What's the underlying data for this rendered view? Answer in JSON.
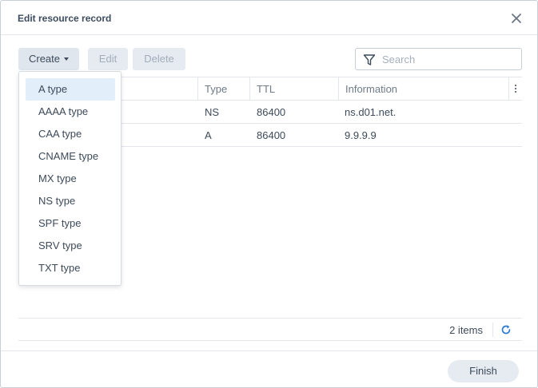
{
  "dialog": {
    "title": "Edit resource record"
  },
  "toolbar": {
    "create_label": "Create",
    "edit_label": "Edit",
    "delete_label": "Delete"
  },
  "search": {
    "placeholder": "Search",
    "value": ""
  },
  "table": {
    "columns": [
      "",
      "Type",
      "TTL",
      "Information"
    ],
    "rows": [
      {
        "type": "NS",
        "ttl": "86400",
        "information": "ns.d01.net."
      },
      {
        "type": "A",
        "ttl": "86400",
        "information": "9.9.9.9"
      }
    ]
  },
  "footer": {
    "item_count": "2 items"
  },
  "actions": {
    "finish_label": "Finish"
  },
  "create_menu": {
    "items": [
      {
        "label": "A type",
        "selected": true
      },
      {
        "label": "AAAA type"
      },
      {
        "label": "CAA type"
      },
      {
        "label": "CNAME type"
      },
      {
        "label": "MX type"
      },
      {
        "label": "NS type"
      },
      {
        "label": "SPF type"
      },
      {
        "label": "SRV type"
      },
      {
        "label": "TXT type"
      }
    ]
  },
  "icons": {
    "close": "close-icon",
    "filter": "filter-icon",
    "refresh": "refresh-icon",
    "column_menu": "vertical-dots-icon"
  },
  "colors": {
    "accent": "#2b7bd1",
    "selected_item_bg": "#e2eefa",
    "button_bg": "#e6ebf1"
  }
}
